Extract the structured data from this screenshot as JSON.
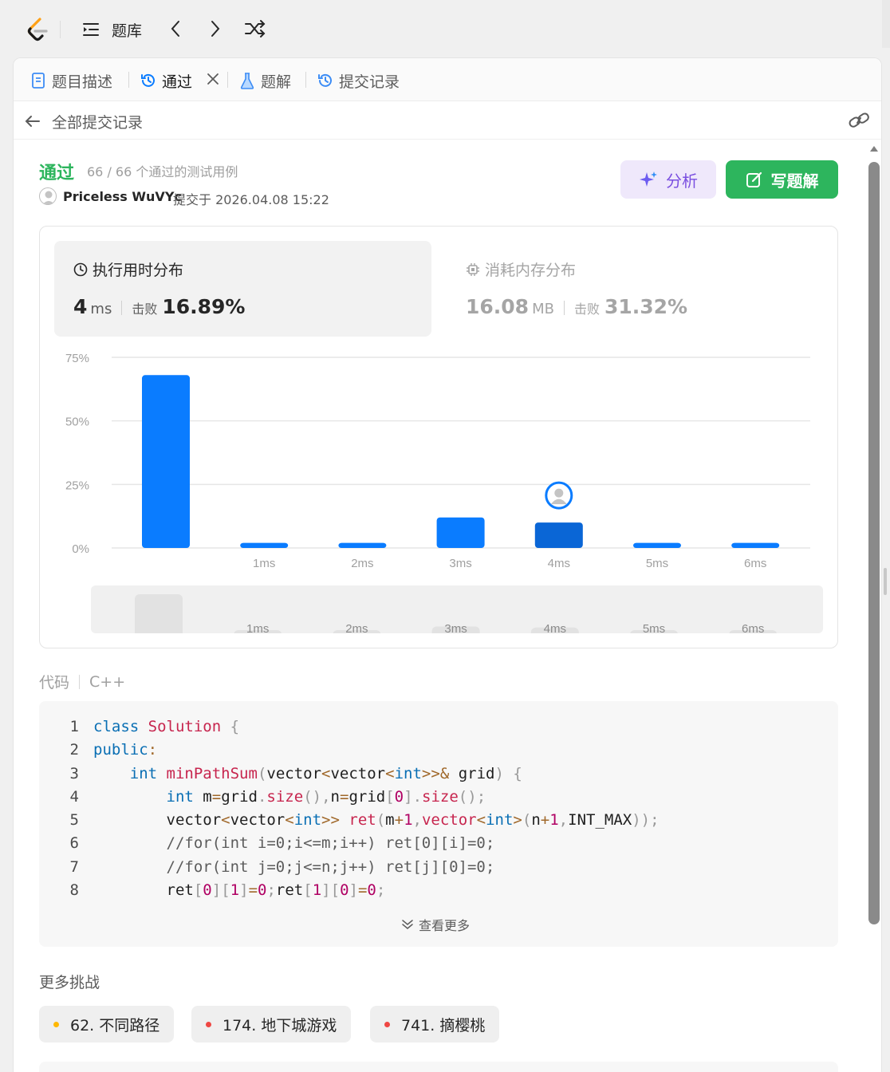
{
  "nav": {
    "title": "题库"
  },
  "tabs": [
    {
      "label": "题目描述"
    },
    {
      "label": "通过"
    },
    {
      "label": "题解"
    },
    {
      "label": "提交记录"
    }
  ],
  "subheader": {
    "title": "全部提交记录"
  },
  "result": {
    "status": "通过",
    "cases": "66 / 66 个通过的测试用例",
    "author": "Priceless WuVYc",
    "submitted": "提交于 2026.04.08 15:22"
  },
  "buttons": {
    "analyze": "分析",
    "write": "写题解"
  },
  "runtime": {
    "title": "执行用时分布",
    "value": "4",
    "unit": "ms",
    "beat_label": "击败",
    "beat": "16.89%"
  },
  "memory": {
    "title": "消耗内存分布",
    "value": "16.08",
    "unit": "MB",
    "beat_label": "击败",
    "beat": "31.32%"
  },
  "chart_data": {
    "type": "bar",
    "categories": [
      "",
      "1ms",
      "2ms",
      "3ms",
      "4ms",
      "5ms",
      "6ms"
    ],
    "values": [
      68,
      2,
      2,
      12,
      10,
      2,
      2
    ],
    "yticks": [
      "0%",
      "25%",
      "50%",
      "75%"
    ],
    "ylim": [
      0,
      75
    ],
    "highlight": "4ms",
    "colors": {
      "bar": "#0a7cff",
      "highlight": "#0a66d6",
      "grid": "#e6e6e6"
    }
  },
  "code": {
    "label": "代码",
    "lang": "C++",
    "lines": [
      "class Solution {",
      "public:",
      "    int minPathSum(vector<vector<int>>& grid) {",
      "        int m=grid.size(),n=grid[0].size();",
      "        vector<vector<int>> ret(m+1,vector<int>(n+1,INT_MAX));",
      "        //for(int i=0;i<=m;i++) ret[0][i]=0;",
      "        //for(int j=0;j<=n;j++) ret[j][0]=0;",
      "        ret[0][1]=0;ret[1][0]=0;"
    ],
    "see_more": "查看更多"
  },
  "more": {
    "title": "更多挑战",
    "items": [
      {
        "label": "62. 不同路径",
        "color": "#ffb800"
      },
      {
        "label": "174. 地下城游戏",
        "color": "#ef4743"
      },
      {
        "label": "741. 摘樱桃",
        "color": "#ef4743"
      }
    ]
  }
}
